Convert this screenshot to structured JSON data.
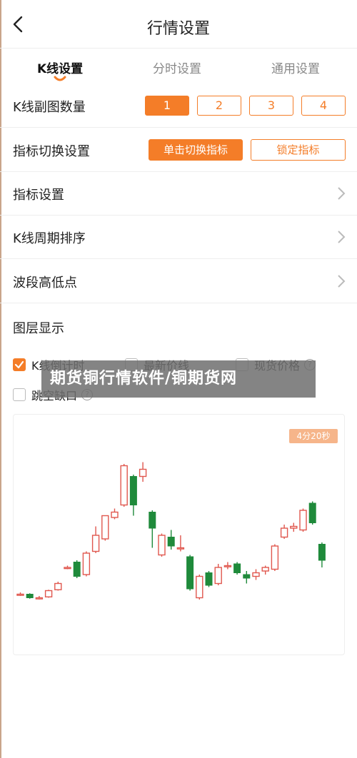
{
  "header": {
    "title": "行情设置",
    "back_icon": "chevron-left-icon"
  },
  "tabs": [
    {
      "label": "K线设置",
      "active": true
    },
    {
      "label": "分时设置",
      "active": false
    },
    {
      "label": "通用设置",
      "active": false
    }
  ],
  "rows": {
    "subchart_count": {
      "label": "K线副图数量",
      "options": [
        "1",
        "2",
        "3",
        "4"
      ],
      "selected": "1"
    },
    "indicator_switch": {
      "label": "指标切换设置",
      "options": [
        "单击切换指标",
        "锁定指标"
      ],
      "selected": "单击切换指标"
    },
    "indicator_settings": {
      "label": "指标设置"
    },
    "kline_period_sort": {
      "label": "K线周期排序"
    },
    "wave_high_low": {
      "label": "波段高低点"
    }
  },
  "layer_display": {
    "title": "图层显示",
    "options": [
      {
        "label": "K线倒计时",
        "checked": true
      },
      {
        "label": "最新价线",
        "checked": false
      },
      {
        "label": "现货价格",
        "checked": false,
        "help_icon": true
      },
      {
        "label": "跳空缺口",
        "checked": false,
        "help_icon": true
      }
    ]
  },
  "watermark": "期货铜行情软件/铜期货网",
  "preview": {
    "countdown_badge": "4分20秒"
  },
  "colors": {
    "accent": "#f47d28",
    "up": "#e0574e",
    "down": "#1f8a3b"
  },
  "chart_data": {
    "type": "candlestick",
    "candles": [
      {
        "o": 3.0,
        "c": 3.0,
        "h": 3.2,
        "l": 2.8
      },
      {
        "o": 3.0,
        "c": 2.6,
        "h": 3.1,
        "l": 2.5
      },
      {
        "o": 2.6,
        "c": 2.6,
        "h": 2.8,
        "l": 2.4
      },
      {
        "o": 2.7,
        "c": 3.4,
        "h": 3.5,
        "l": 2.6
      },
      {
        "o": 3.5,
        "c": 4.2,
        "h": 4.4,
        "l": 3.4
      },
      {
        "o": 6.0,
        "c": 6.0,
        "h": 6.2,
        "l": 5.8
      },
      {
        "o": 6.6,
        "c": 5.0,
        "h": 6.8,
        "l": 4.8
      },
      {
        "o": 5.2,
        "c": 7.6,
        "h": 7.8,
        "l": 5.0
      },
      {
        "o": 7.8,
        "c": 9.6,
        "h": 10.6,
        "l": 7.6
      },
      {
        "o": 9.2,
        "c": 11.8,
        "h": 11.8,
        "l": 9.0
      },
      {
        "o": 11.6,
        "c": 12.2,
        "h": 12.6,
        "l": 11.4
      },
      {
        "o": 13.0,
        "c": 17.4,
        "h": 17.6,
        "l": 12.8
      },
      {
        "o": 16.2,
        "c": 13.0,
        "h": 16.4,
        "l": 11.8
      },
      {
        "o": 16.2,
        "c": 17.0,
        "h": 17.8,
        "l": 15.6
      },
      {
        "o": 12.2,
        "c": 10.4,
        "h": 12.4,
        "l": 8.2
      },
      {
        "o": 7.4,
        "c": 9.6,
        "h": 9.8,
        "l": 7.2
      },
      {
        "o": 9.4,
        "c": 8.4,
        "h": 10.2,
        "l": 8.0
      },
      {
        "o": 8.2,
        "c": 8.2,
        "h": 9.6,
        "l": 7.8
      },
      {
        "o": 7.2,
        "c": 3.6,
        "h": 7.4,
        "l": 3.4
      },
      {
        "o": 2.6,
        "c": 5.0,
        "h": 5.2,
        "l": 2.4
      },
      {
        "o": 5.4,
        "c": 4.0,
        "h": 5.6,
        "l": 3.8
      },
      {
        "o": 4.2,
        "c": 6.0,
        "h": 6.4,
        "l": 4.0
      },
      {
        "o": 6.2,
        "c": 6.2,
        "h": 6.6,
        "l": 5.8
      },
      {
        "o": 6.4,
        "c": 5.4,
        "h": 6.6,
        "l": 5.2
      },
      {
        "o": 5.2,
        "c": 4.8,
        "h": 5.6,
        "l": 4.2
      },
      {
        "o": 5.0,
        "c": 5.4,
        "h": 5.8,
        "l": 4.6
      },
      {
        "o": 5.6,
        "c": 6.0,
        "h": 6.2,
        "l": 5.2
      },
      {
        "o": 5.8,
        "c": 8.4,
        "h": 8.6,
        "l": 5.6
      },
      {
        "o": 9.4,
        "c": 10.4,
        "h": 10.8,
        "l": 9.2
      },
      {
        "o": 10.4,
        "c": 10.6,
        "h": 11.0,
        "l": 10.0
      },
      {
        "o": 10.2,
        "c": 12.4,
        "h": 12.6,
        "l": 10.0
      },
      {
        "o": 13.2,
        "c": 11.0,
        "h": 13.4,
        "l": 10.8
      },
      {
        "o": 8.6,
        "c": 6.8,
        "h": 8.8,
        "l": 6.0
      }
    ],
    "ylim": [
      0,
      20
    ]
  }
}
